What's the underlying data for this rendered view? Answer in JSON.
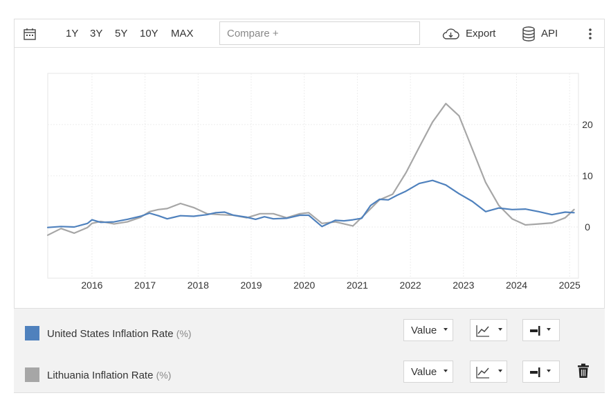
{
  "toolbar": {
    "ranges": [
      "1Y",
      "3Y",
      "5Y",
      "10Y",
      "MAX"
    ],
    "compare_placeholder": "Compare +",
    "export_label": "Export",
    "api_label": "API",
    "icons": [
      "calendar-icon",
      "cloud-download-icon",
      "database-icon",
      "more-vertical-icon"
    ]
  },
  "legend": {
    "items": [
      {
        "name": "United States Inflation Rate",
        "unit": "(%)",
        "color": "#4f81bd",
        "value_label": "Value"
      },
      {
        "name": "Lithuania Inflation Rate",
        "unit": "(%)",
        "color": "#a6a6a6",
        "value_label": "Value"
      }
    ]
  },
  "chart_data": {
    "type": "line",
    "title": "",
    "xlabel": "",
    "ylabel": "",
    "xlim": [
      "2015-03",
      "2025-03"
    ],
    "ylim": [
      -10,
      30
    ],
    "yticks": [
      0,
      10,
      20
    ],
    "xticks": [
      "2016",
      "2017",
      "2018",
      "2019",
      "2020",
      "2021",
      "2022",
      "2023",
      "2024",
      "2025"
    ],
    "y_axis_position": "right",
    "grid": true,
    "series": [
      {
        "name": "United States Inflation Rate",
        "color": "#4f81bd",
        "points": [
          [
            "2015-03",
            -0.1
          ],
          [
            "2015-06",
            0.1
          ],
          [
            "2015-09",
            0.0
          ],
          [
            "2015-12",
            0.7
          ],
          [
            "2016-01",
            1.4
          ],
          [
            "2016-03",
            0.9
          ],
          [
            "2016-06",
            1.0
          ],
          [
            "2016-09",
            1.5
          ],
          [
            "2016-12",
            2.1
          ],
          [
            "2017-02",
            2.7
          ],
          [
            "2017-04",
            2.2
          ],
          [
            "2017-06",
            1.6
          ],
          [
            "2017-09",
            2.2
          ],
          [
            "2017-12",
            2.1
          ],
          [
            "2018-03",
            2.4
          ],
          [
            "2018-05",
            2.8
          ],
          [
            "2018-07",
            2.9
          ],
          [
            "2018-09",
            2.3
          ],
          [
            "2018-12",
            1.9
          ],
          [
            "2019-02",
            1.5
          ],
          [
            "2019-04",
            2.0
          ],
          [
            "2019-06",
            1.6
          ],
          [
            "2019-09",
            1.7
          ],
          [
            "2019-12",
            2.3
          ],
          [
            "2020-02",
            2.3
          ],
          [
            "2020-05",
            0.1
          ],
          [
            "2020-08",
            1.3
          ],
          [
            "2020-10",
            1.2
          ],
          [
            "2020-12",
            1.4
          ],
          [
            "2021-02",
            1.7
          ],
          [
            "2021-04",
            4.2
          ],
          [
            "2021-06",
            5.4
          ],
          [
            "2021-08",
            5.3
          ],
          [
            "2021-10",
            6.2
          ],
          [
            "2021-12",
            7.0
          ],
          [
            "2022-03",
            8.5
          ],
          [
            "2022-06",
            9.1
          ],
          [
            "2022-09",
            8.2
          ],
          [
            "2022-12",
            6.5
          ],
          [
            "2023-03",
            5.0
          ],
          [
            "2023-06",
            3.0
          ],
          [
            "2023-09",
            3.7
          ],
          [
            "2023-12",
            3.4
          ],
          [
            "2024-03",
            3.5
          ],
          [
            "2024-06",
            3.0
          ],
          [
            "2024-09",
            2.4
          ],
          [
            "2024-12",
            2.9
          ],
          [
            "2025-02",
            2.8
          ]
        ]
      },
      {
        "name": "Lithuania Inflation Rate",
        "color": "#a6a6a6",
        "points": [
          [
            "2015-03",
            -1.6
          ],
          [
            "2015-06",
            -0.3
          ],
          [
            "2015-09",
            -1.2
          ],
          [
            "2015-12",
            -0.1
          ],
          [
            "2016-01",
            0.7
          ],
          [
            "2016-03",
            1.1
          ],
          [
            "2016-06",
            0.6
          ],
          [
            "2016-09",
            1.0
          ],
          [
            "2016-12",
            1.9
          ],
          [
            "2017-02",
            3.0
          ],
          [
            "2017-04",
            3.4
          ],
          [
            "2017-06",
            3.6
          ],
          [
            "2017-09",
            4.6
          ],
          [
            "2017-12",
            3.8
          ],
          [
            "2018-03",
            2.6
          ],
          [
            "2018-06",
            2.4
          ],
          [
            "2018-09",
            2.3
          ],
          [
            "2018-12",
            1.8
          ],
          [
            "2019-03",
            2.6
          ],
          [
            "2019-06",
            2.6
          ],
          [
            "2019-09",
            1.8
          ],
          [
            "2019-12",
            2.6
          ],
          [
            "2020-02",
            2.8
          ],
          [
            "2020-05",
            0.7
          ],
          [
            "2020-08",
            1.0
          ],
          [
            "2020-12",
            0.2
          ],
          [
            "2021-03",
            2.7
          ],
          [
            "2021-06",
            5.3
          ],
          [
            "2021-09",
            6.4
          ],
          [
            "2021-12",
            10.6
          ],
          [
            "2022-03",
            15.6
          ],
          [
            "2022-06",
            20.5
          ],
          [
            "2022-09",
            24.1
          ],
          [
            "2022-12",
            21.7
          ],
          [
            "2023-03",
            15.2
          ],
          [
            "2023-06",
            8.7
          ],
          [
            "2023-09",
            4.2
          ],
          [
            "2023-12",
            1.6
          ],
          [
            "2024-03",
            0.4
          ],
          [
            "2024-06",
            0.6
          ],
          [
            "2024-09",
            0.8
          ],
          [
            "2024-12",
            1.8
          ],
          [
            "2025-02",
            3.4
          ]
        ]
      }
    ]
  }
}
